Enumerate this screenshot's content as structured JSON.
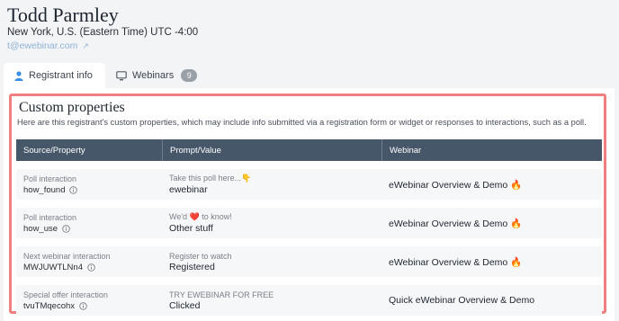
{
  "header": {
    "name": "Todd Parmley",
    "timezone": "New York, U.S. (Eastern Time) UTC -4:00",
    "email": "t@ewebinar.com",
    "email_ext_icon": "external-link-icon"
  },
  "tabs": [
    {
      "label": "Registrant info",
      "icon": "person-icon",
      "active": true
    },
    {
      "label": "Webinars",
      "icon": "monitor-icon",
      "count": "9",
      "active": false
    }
  ],
  "custom_properties": {
    "title": "Custom properties",
    "description": "Here are this registrant's custom properties, which may include info submitted via a registration form or widget or responses to interactions, such as a poll.",
    "columns": [
      "Source/Property",
      "Prompt/Value",
      "Webinar"
    ],
    "rows": [
      {
        "source": "Poll interaction",
        "property": "how_found",
        "prompt": "Take this poll here...👇",
        "value": "ewebinar",
        "webinar": "eWebinar Overview & Demo 🔥"
      },
      {
        "source": "Poll interaction",
        "property": "how_use",
        "prompt": "We'd ❤️ to know!",
        "value": "Other stuff",
        "webinar": "eWebinar Overview & Demo 🔥"
      },
      {
        "source": "Next webinar interaction",
        "property": "MWJUWTLNn4",
        "prompt": "Register to watch",
        "value": "Registered",
        "webinar": "eWebinar Overview & Demo 🔥"
      },
      {
        "source": "Special offer interaction",
        "property": "tvuTMqecohx",
        "prompt": "TRY EWEBINAR FOR FREE",
        "value": "Clicked",
        "webinar": "Quick eWebinar Overview & Demo"
      }
    ]
  },
  "colors": {
    "accent_border": "#f07f80",
    "table_header": "#47576a",
    "link": "#8fb3d6"
  }
}
